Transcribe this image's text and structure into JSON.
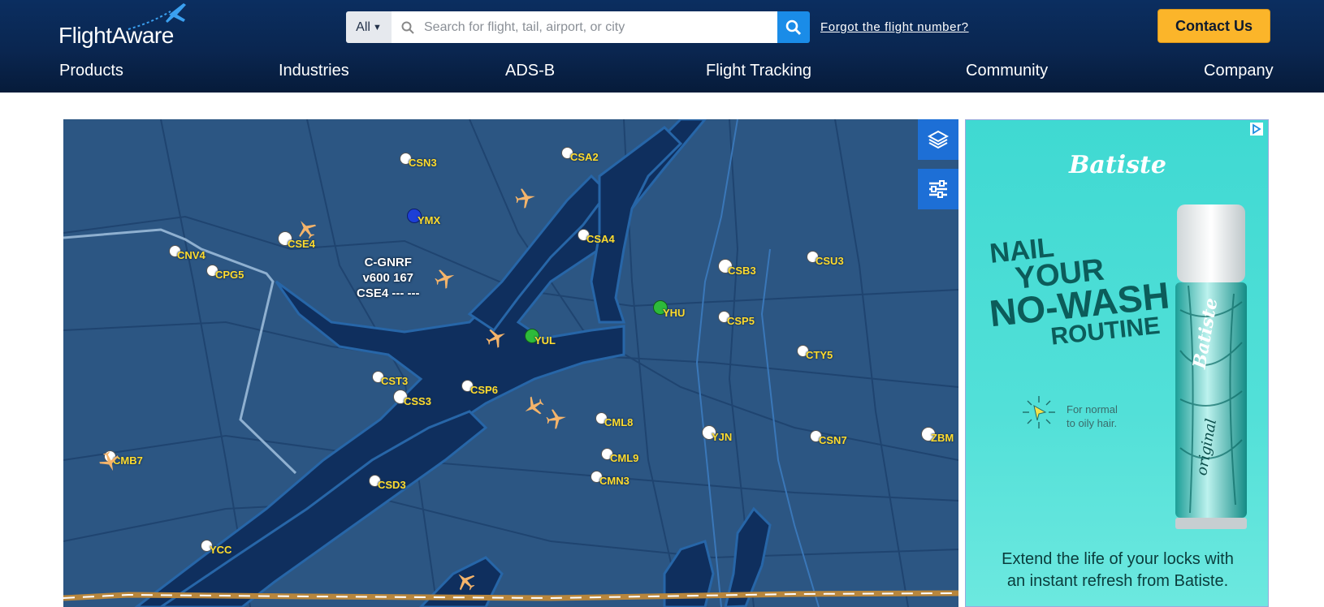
{
  "header": {
    "logo_text": "FlightAware",
    "search": {
      "scope": "All",
      "placeholder": "Search for flight, tail, airport, or city"
    },
    "forgot_link": "Forgot the flight number?",
    "contact_button": "Contact Us"
  },
  "nav": {
    "items": [
      {
        "label": "Products"
      },
      {
        "label": "Industries"
      },
      {
        "label": "ADS-B"
      },
      {
        "label": "Flight Tracking"
      },
      {
        "label": "Community"
      },
      {
        "label": "Company"
      }
    ]
  },
  "map": {
    "flight_tag": {
      "callsign": "C-GNRF",
      "type_alt": "v600 167",
      "route": "CSE4 --- ---"
    },
    "airports": {
      "CSN3": "CSN3",
      "CSA2": "CSA2",
      "YMX": "YMX",
      "CSE4": "CSE4",
      "CNV4": "CNV4",
      "CPG5": "CPG5",
      "CSA4": "CSA4",
      "CSB3": "CSB3",
      "CSU3": "CSU3",
      "YHU": "YHU",
      "CSP5": "CSP5",
      "YUL": "YUL",
      "CTY5": "CTY5",
      "CST3": "CST3",
      "CSP6": "CSP6",
      "CSS3": "CSS3",
      "CML8": "CML8",
      "YJN": "YJN",
      "CSN7": "CSN7",
      "ZBM": "ZBM",
      "CMB7": "CMB7",
      "CML9": "CML9",
      "CMN3": "CMN3",
      "CSD3": "CSD3",
      "YCC": "YCC"
    },
    "colors": {
      "water": "#0f2f5e",
      "land": "#2c5683",
      "aircraft": "#f5b46a",
      "label": "#ffdc2e",
      "yul_dot": "#2dbb3a",
      "ymx_dot": "#1d3fd6"
    }
  },
  "ad": {
    "brand": "Batiste",
    "headline": [
      "NAIL",
      "YOUR",
      "NO-WASH",
      "ROUTINE"
    ],
    "subtext": [
      "For normal",
      "to oily hair."
    ],
    "bottom_copy": [
      "Extend the life of your locks with",
      "an instant refresh from Batiste."
    ],
    "can_label": "original"
  }
}
